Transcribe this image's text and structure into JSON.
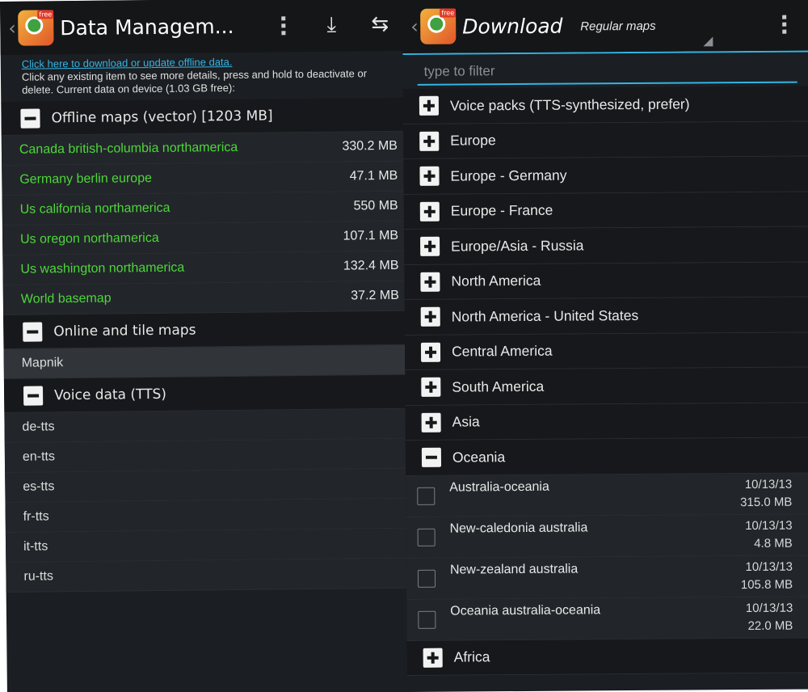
{
  "left": {
    "title": "Data Managem...",
    "info_link": "Click here to download or update offline data.",
    "info_text": "Click any existing item to see more details, press and hold to deactivate or delete. Current data on device (1.03 GB free):",
    "groups": [
      {
        "label": "Offline maps (vector) [1203 MB]",
        "items": [
          {
            "name": "Canada british-columbia northamerica",
            "size": "330.2 MB"
          },
          {
            "name": "Germany berlin europe",
            "size": "47.1 MB"
          },
          {
            "name": "Us california northamerica",
            "size": "550 MB"
          },
          {
            "name": "Us oregon northamerica",
            "size": "107.1 MB"
          },
          {
            "name": "Us washington northamerica",
            "size": "132.4 MB"
          },
          {
            "name": "World basemap",
            "size": "37.2 MB"
          }
        ]
      },
      {
        "label": "Online and tile maps",
        "items": [
          {
            "name": "Mapnik"
          }
        ]
      },
      {
        "label": "Voice data (TTS)",
        "items": [
          {
            "name": "de-tts"
          },
          {
            "name": "en-tts"
          },
          {
            "name": "es-tts"
          },
          {
            "name": "fr-tts"
          },
          {
            "name": "it-tts"
          },
          {
            "name": "ru-tts"
          }
        ]
      }
    ]
  },
  "right": {
    "title": "Download",
    "selector": "Regular maps",
    "filter_placeholder": "type to filter",
    "groups_before": [
      "Voice packs (TTS-synthesized, prefer)",
      "Europe",
      "Europe - Germany",
      "Europe - France",
      "Europe/Asia - Russia",
      "North America",
      "North America - United States",
      "Central America",
      "South America",
      "Asia"
    ],
    "expanded_group": "Oceania",
    "expanded_items": [
      {
        "name": "Australia-oceania",
        "date": "10/13/13",
        "size": "315.0 MB"
      },
      {
        "name": "New-caledonia australia",
        "date": "10/13/13",
        "size": "4.8 MB"
      },
      {
        "name": "New-zealand australia",
        "date": "10/13/13",
        "size": "105.8 MB"
      },
      {
        "name": "Oceania australia-oceania",
        "date": "10/13/13",
        "size": "22.0 MB"
      }
    ],
    "groups_after": [
      "Africa"
    ]
  },
  "colors": {
    "accent": "#33b5e5",
    "installed_map_text": "#4ed63a",
    "background": "#1b1e22"
  },
  "icons": {
    "download": "download-icon",
    "update": "update-icon",
    "overflow": "overflow-menu-icon"
  }
}
